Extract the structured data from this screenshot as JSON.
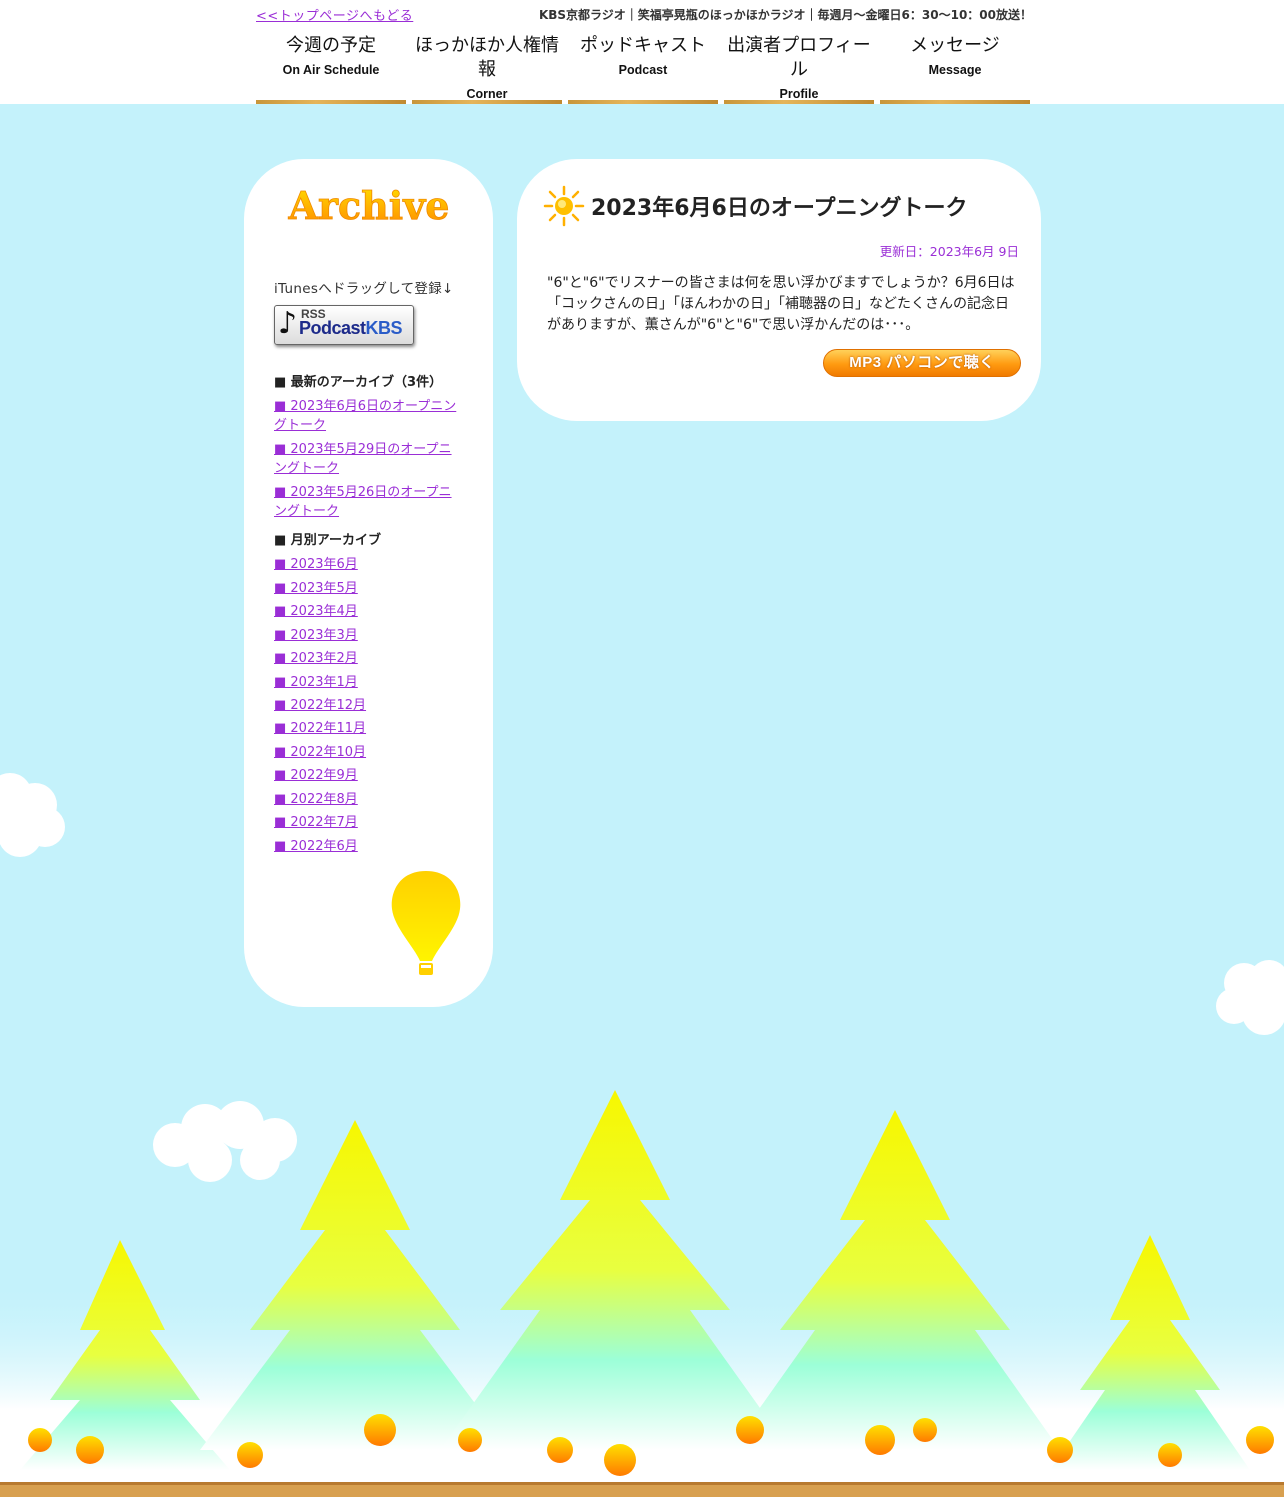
{
  "header": {
    "top_link": "<<トップページへもどる",
    "tagline": "KBS京都ラジオ｜笑福亭晃瓶のほっかほかラジオ｜毎週月〜金曜日6：30〜10：00放送！",
    "nav": [
      {
        "jp": "今週の予定",
        "en": "On Air Schedule"
      },
      {
        "jp": "ほっかほか人権情報",
        "en": "Corner"
      },
      {
        "jp": "ポッドキャスト",
        "en": "Podcast"
      },
      {
        "jp": "出演者プロフィール",
        "en": "Profile"
      },
      {
        "jp": "メッセージ",
        "en": "Message"
      }
    ]
  },
  "sidebar": {
    "logo_text": "Archive",
    "itunes_text": "iTunesへドラッグして登録↓",
    "rss_badge": {
      "rss": "RSS",
      "podcast": "Podcast",
      "kbs": "KBS"
    },
    "latest_heading": "■ 最新のアーカイブ（3件）",
    "latest": [
      "■ 2023年6月6日のオープニングトーク",
      "■ 2023年5月29日のオープニングトーク",
      "■ 2023年5月26日のオープニングトーク"
    ],
    "monthly_heading": "■ 月別アーカイブ",
    "monthly": [
      "■ 2023年6月",
      "■ 2023年5月",
      "■ 2023年4月",
      "■ 2023年3月",
      "■ 2023年2月",
      "■ 2023年1月",
      "■ 2022年12月",
      "■ 2022年11月",
      "■ 2022年10月",
      "■ 2022年9月",
      "■ 2022年8月",
      "■ 2022年7月",
      "■ 2022年6月"
    ]
  },
  "main": {
    "title": "2023年6月6日のオープニングトーク",
    "updated": "更新日：2023年6月 9日",
    "body": "\"6\"と\"6\"でリスナーの皆さまは何を思い浮かびますでしょうか？6月6日は「コックさんの日」「ほんわかの日」「補聴器の日」などたくさんの記念日がありますが、薫さんが\"6\"と\"6\"で思い浮かんだのは･･･。",
    "mp3_button": "MP3 パソコンで聴く"
  },
  "colors": {
    "sky": "#c4f2fb",
    "link": "#9a2ed6",
    "accent_orange": "#ff9a10",
    "tree_yellow": "#f7f700"
  }
}
